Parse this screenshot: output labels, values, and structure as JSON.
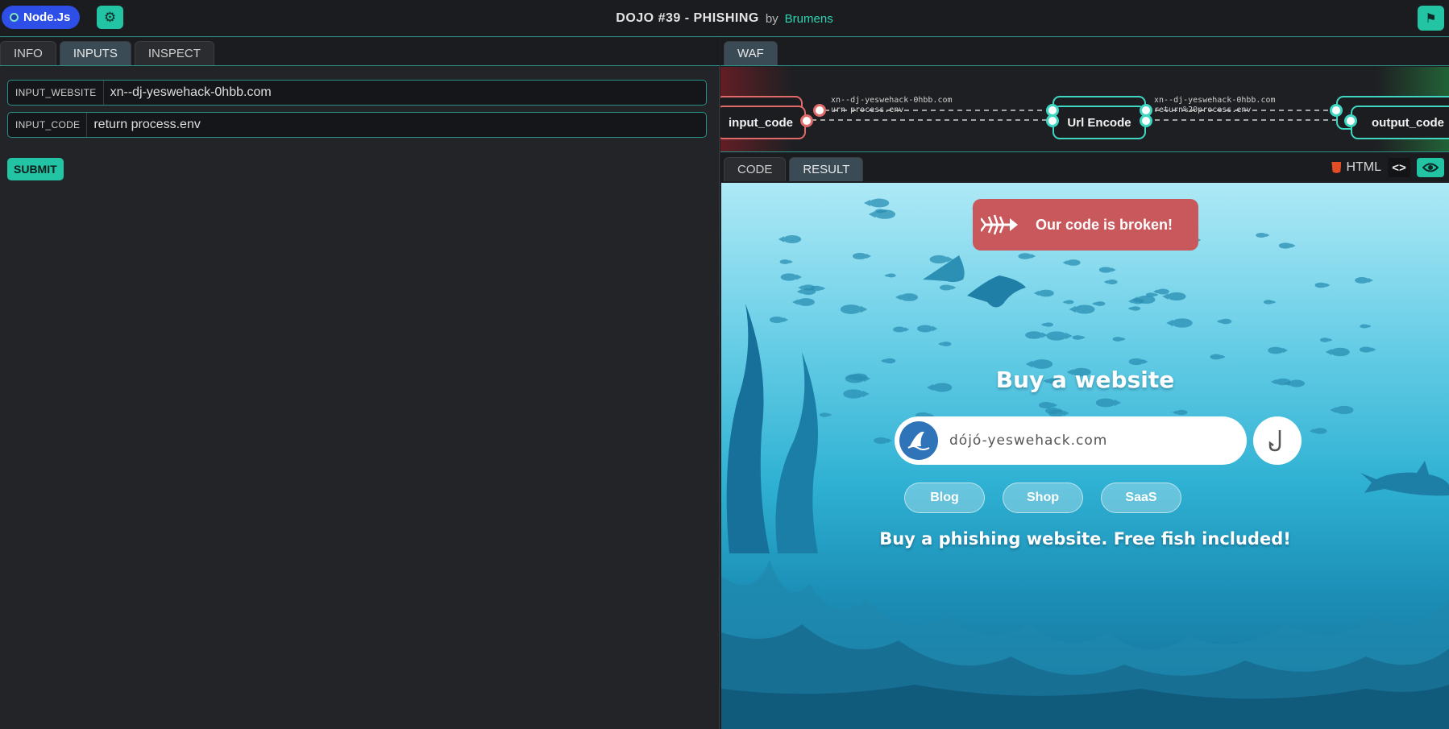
{
  "topbar": {
    "runtime": "Node.Js",
    "title": "DOJO #39 - PHISHING",
    "by": "by",
    "author": "Brumens"
  },
  "left": {
    "tabs": [
      "INFO",
      "INPUTS",
      "INSPECT"
    ],
    "active_tab": "INPUTS",
    "inputs": [
      {
        "label": "INPUT_WEBSITE",
        "value": "xn--dj-yeswehack-0hbb.com"
      },
      {
        "label": "INPUT_CODE",
        "value": "return process.env"
      }
    ],
    "submit_label": "SUBMIT"
  },
  "waf": {
    "tab": "WAF",
    "nodes": {
      "input": "input_code",
      "middle": "Url Encode",
      "output": "output_code"
    },
    "edges": {
      "a1": "xn--dj-yeswehack-0hbb.com",
      "a2": "urn process.env",
      "b1": "xn--dj-yeswehack-0hbb.com",
      "b2": "return%20process.env"
    }
  },
  "result": {
    "tabs": [
      "CODE",
      "RESULT"
    ],
    "active_tab": "RESULT",
    "format_label": "HTML",
    "code_toggle": "<>",
    "page": {
      "error_badge": "Our code is broken!",
      "heading": "Buy a website",
      "search_value": "dójó-yeswehack.com",
      "links": [
        "Blog",
        "Shop",
        "SaaS"
      ],
      "tagline": "Buy a phishing website. Free fish included!"
    }
  },
  "colors": {
    "accent": "#22c4a4",
    "runtime_badge": "#2e4ee8",
    "error": "#c8585b"
  }
}
